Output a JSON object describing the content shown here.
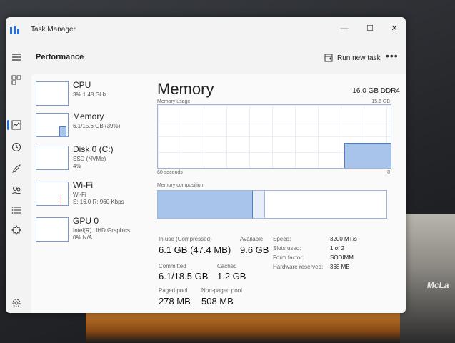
{
  "window": {
    "title": "Task Manager",
    "minimize": "—",
    "maximize": "☐",
    "close": "✕"
  },
  "header": {
    "page": "Performance",
    "run_task": "Run new task",
    "more": "•••"
  },
  "sidebar": [
    {
      "name": "CPU",
      "lines": [
        "3% 1.48 GHz"
      ]
    },
    {
      "name": "Memory",
      "lines": [
        "6.1/15.6 GB (39%)"
      ]
    },
    {
      "name": "Disk 0 (C:)",
      "lines": [
        "SSD (NVMe)",
        "4%"
      ]
    },
    {
      "name": "Wi-Fi",
      "lines": [
        "Wi-Fi",
        "S: 16.0 R: 960 Kbps"
      ]
    },
    {
      "name": "GPU 0",
      "lines": [
        "Intel(R) UHD Graphics",
        "0% N/A"
      ]
    }
  ],
  "detail": {
    "title": "Memory",
    "spec": "16.0 GB DDR4",
    "usage_label": "Memory usage",
    "usage_max": "15.6 GB",
    "time_label": "60 seconds",
    "time_end": "0",
    "composition_label": "Memory composition",
    "usage_graph_fraction": 0.39,
    "stats": {
      "in_use_label": "In use (Compressed)",
      "in_use": "6.1 GB (47.4 MB)",
      "available_label": "Available",
      "available": "9.6 GB",
      "committed_label": "Committed",
      "committed": "6.1/18.5 GB",
      "cached_label": "Cached",
      "cached": "1.2 GB",
      "paged_label": "Paged pool",
      "paged": "278 MB",
      "nonpaged_label": "Non-paged pool",
      "nonpaged": "508 MB"
    },
    "specs": [
      {
        "key": "Speed:",
        "value": "3200 MT/s"
      },
      {
        "key": "Slots used:",
        "value": "1 of 2"
      },
      {
        "key": "Form factor:",
        "value": "SODIMM"
      },
      {
        "key": "Hardware reserved:",
        "value": "368 MB"
      }
    ]
  },
  "backdrop_text": "McLa",
  "colors": {
    "accent": "#2b6cd9",
    "graph_fill": "#a9c4ea",
    "graph_line": "#4b7fcc"
  }
}
